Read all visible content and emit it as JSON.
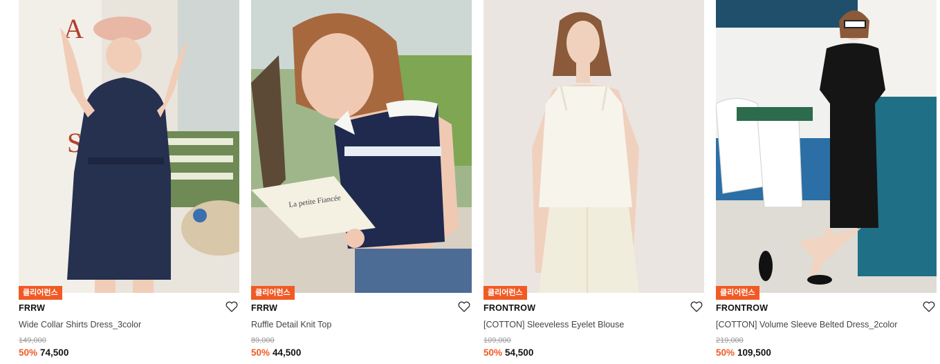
{
  "products": [
    {
      "badge": "클리어런스",
      "brand": "FRRW",
      "name": "Wide Collar Shirts Dress_3color",
      "original_price": "149,000",
      "discount": "50%",
      "price": "74,500",
      "wishlist_icon": "heart-outline-icon"
    },
    {
      "badge": "클리어런스",
      "brand": "FRRW",
      "name": "Ruffle Detail Knit Top",
      "original_price": "89,000",
      "discount": "50%",
      "price": "44,500",
      "wishlist_icon": "heart-outline-icon"
    },
    {
      "badge": "클리어런스",
      "brand": "FRONTROW",
      "name": "[COTTON] Sleeveless Eyelet Blouse",
      "original_price": "109,000",
      "discount": "50%",
      "price": "54,500",
      "wishlist_icon": "heart-outline-icon"
    },
    {
      "badge": "클리어런스",
      "brand": "FRONTROW",
      "name": "[COTTON] Volume Sleeve Belted Dress_2color",
      "original_price": "219,000",
      "discount": "50%",
      "price": "109,500",
      "wishlist_icon": "heart-outline-icon"
    }
  ],
  "colors": {
    "badge_bg": "#f15a24",
    "discount": "#f15a24",
    "brand_text": "#111111",
    "strike_price": "#999999"
  }
}
